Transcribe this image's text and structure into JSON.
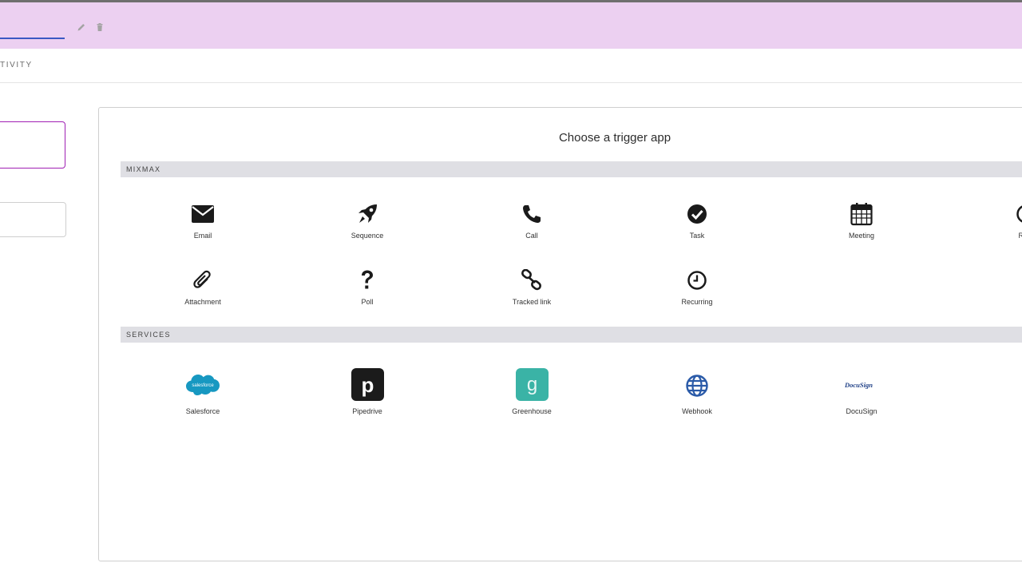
{
  "header": {
    "edit_icon": "pencil-icon",
    "delete_icon": "trash-icon"
  },
  "tabs": {
    "active_label": "TIVITY"
  },
  "panel": {
    "title": "Choose a trigger app",
    "sections": [
      {
        "label": "MIXMAX",
        "items": [
          {
            "label": "Email",
            "icon": "envelope-icon"
          },
          {
            "label": "Sequence",
            "icon": "rocket-icon"
          },
          {
            "label": "Call",
            "icon": "phone-icon"
          },
          {
            "label": "Task",
            "icon": "check-circle-icon"
          },
          {
            "label": "Meeting",
            "icon": "calendar-icon"
          },
          {
            "label": "Rem",
            "icon": "reminder-icon"
          },
          {
            "label": "Attachment",
            "icon": "paperclip-icon"
          },
          {
            "label": "Poll",
            "icon": "question-icon"
          },
          {
            "label": "Tracked link",
            "icon": "link-icon"
          },
          {
            "label": "Recurring",
            "icon": "clock-icon"
          }
        ]
      },
      {
        "label": "SERVICES",
        "items": [
          {
            "label": "Salesforce",
            "icon": "salesforce-logo-icon",
            "logo_text": "salesforce",
            "color": "#1798c1"
          },
          {
            "label": "Pipedrive",
            "icon": "pipedrive-logo-icon",
            "logo_text": "p",
            "color": "#1b1b1b"
          },
          {
            "label": "Greenhouse",
            "icon": "greenhouse-logo-icon",
            "logo_text": "g",
            "color": "#3ab3a6"
          },
          {
            "label": "Webhook",
            "icon": "globe-icon",
            "color": "#2a5aa8"
          },
          {
            "label": "DocuSign",
            "icon": "docusign-logo-icon",
            "logo_text": "DocuSign",
            "color": "#1e3f86"
          }
        ]
      }
    ]
  },
  "colors": {
    "header_bg": "#ecd0f1",
    "focus_border": "#a020b4",
    "underline": "#3a59c4",
    "section_bg": "#dfdfe4"
  }
}
